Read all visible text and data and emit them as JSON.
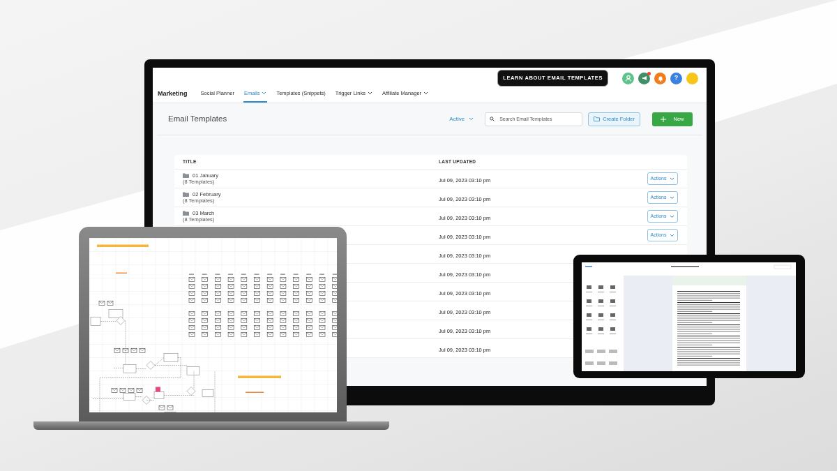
{
  "header": {
    "help_button": "LEARN ABOUT EMAIL TEMPLATES",
    "help_glyph": "?",
    "notification_dot": true,
    "app": "Marketing",
    "tabs": [
      {
        "label": "Social Planner",
        "selected": false,
        "dropdown": false
      },
      {
        "label": "Emails",
        "selected": true,
        "dropdown": true
      },
      {
        "label": "Templates (Snippets)",
        "selected": false,
        "dropdown": false
      },
      {
        "label": "Trigger Links",
        "selected": false,
        "dropdown": true
      },
      {
        "label": "Affiliate Manager",
        "selected": false,
        "dropdown": true
      }
    ]
  },
  "page": {
    "title": "Email Templates",
    "filter": "Active",
    "search": {
      "placeholder": "Search Email Templates"
    },
    "buttons": [
      {
        "label": "Create Folder",
        "kind": "outline"
      },
      {
        "label": "New",
        "kind": "primary"
      }
    ]
  },
  "table": {
    "columns": [
      "TITLE",
      "LAST UPDATED"
    ],
    "rows": [
      {
        "title": "01 January",
        "count": "(8 Templates)",
        "updated": "Jul 09, 2023 03:10 pm",
        "action": "Actions"
      },
      {
        "title": "02 February",
        "count": "(8 Templates)",
        "updated": "Jul 09, 2023 03:10 pm",
        "action": "Actions"
      },
      {
        "title": "03 March",
        "count": "(8 Templates)",
        "updated": "Jul 09, 2023 03:10 pm",
        "action": "Actions"
      },
      {
        "updated": "Jul 09, 2023 03:10 pm",
        "action": "Actions"
      },
      {
        "updated": "Jul 09, 2023 03:10 pm"
      },
      {
        "updated": "Jul 09, 2023 03:10 pm"
      },
      {
        "updated": "Jul 09, 2023 03:10 pm"
      },
      {
        "updated": "Jul 09, 2023 03:10 pm"
      },
      {
        "updated": "Jul 09, 2023 03:10 pm"
      },
      {
        "updated": "Jul 09, 2023 03:10 pm"
      }
    ]
  }
}
